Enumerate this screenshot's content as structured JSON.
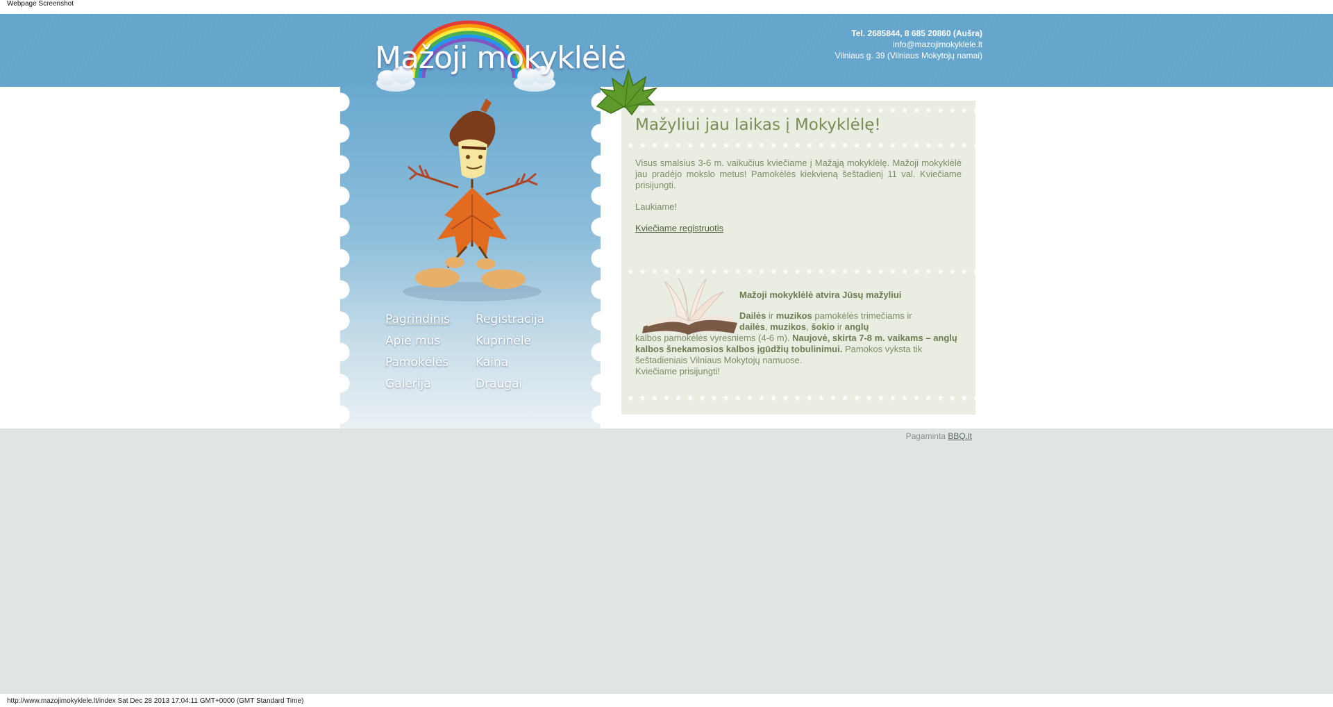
{
  "screenshot_label": "Webpage Screenshot",
  "logo": {
    "text": "Mažoji mokyklėlė"
  },
  "contact": {
    "phone": "Tel. 2685844, 8 685 20860 (Aušra)",
    "email": "info@mazojimokyklele.lt",
    "address": "Vilniaus g. 39 (Vilniaus Mokytojų namai)"
  },
  "nav": {
    "items": [
      {
        "label": "Pagrindinis",
        "active": true
      },
      {
        "label": "Registracija"
      },
      {
        "label": "Apie mus"
      },
      {
        "label": "Kuprinėlė"
      },
      {
        "label": "Pamokėlės"
      },
      {
        "label": "Kaina"
      },
      {
        "label": "Galerija"
      },
      {
        "label": "Draugai"
      }
    ]
  },
  "main": {
    "title": "Mažyliui jau laikas į Mokyklėlę!",
    "intro": "Visus smalsius 3-6 m. vaikučius kviečiame  į Mažąją mokyklėlę. Mažoji mokyklėlė jau pradėjo mokslo metus! Pamokėlės kiekvieną šeštadienį 11 val.  Kviečiame prisijungti.",
    "welcome": "Laukiame!",
    "register_link": "Kviečiame registruotis"
  },
  "promo": {
    "title": "Mažoji  mokyklėlė atvira Jūsų mažyliui",
    "b1": "Dailės",
    "t1": " ir ",
    "b2": "muzikos",
    "t2": " pamokėlės trimečiams ir",
    "b3": "dailės",
    "t3": ", ",
    "b4": "muzikos",
    "t4": ", ",
    "b5": "šokio",
    "t5": " ir ",
    "b6": "anglų",
    "t6": "kalbos pamokėlės vyresniems (4-6 m). ",
    "b7": "Naujovė, skirta 7-8 m. vaikams – anglų kalbos šnekamosios kalbos įgūdžių tobulinimui.",
    "t7": "  Pamokos vyksta tik šeštadieniais Vilniaus Mokytojų namuose.",
    "t8": "Kviečiame prisijungti!"
  },
  "footer": {
    "credit_prefix": "Pagaminta ",
    "credit_link": "BBQ.lt"
  },
  "statusbar": "http://www.mazojimokyklele.lt/index Sat Dec 28 2013 17:04:11 GMT+0000 (GMT Standard Time)"
}
